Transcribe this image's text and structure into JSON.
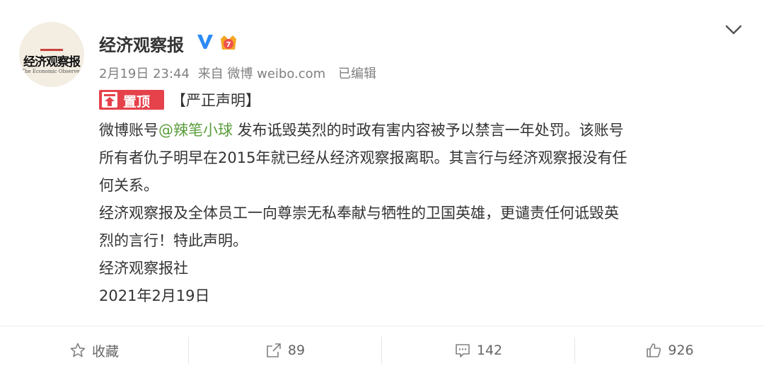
{
  "post": {
    "author": {
      "name": "经济观察报",
      "avatar_cn": "经济观察报",
      "avatar_en": "The Economic Observer",
      "verified_color": "#2b8af7"
    },
    "meta": {
      "time": "2月19日 23:44",
      "source": "来自 微博 weibo.com",
      "edited": "已编辑"
    },
    "pinned_label": "置顶",
    "title": "【严正声明】",
    "body": {
      "line1_pre": "微博账号",
      "mention": "@辣笔小球",
      "line1_post": " 发布诋毁英烈的时政有害内容被予以禁言一年处罚。该账号",
      "line2": "所有者仇子明早在2015年就已经从经济观察报离职。其言行与经济观察报没有任",
      "line3": "何关系。",
      "line4": "经济观察报及全体员工一向尊崇无私奉献与牺牲的卫国英雄，更谴责任何诋毁英",
      "line5": "烈的言行！特此声明。",
      "line6": "经济观察报社",
      "line7": "2021年2月19日"
    },
    "actions": {
      "favorite_label": "收藏",
      "repost_count": "89",
      "comment_count": "142",
      "like_count": "926"
    },
    "colors": {
      "mention": "#5b9d3c",
      "pin_tag": "#e5424c",
      "meta_text": "#808080"
    }
  }
}
